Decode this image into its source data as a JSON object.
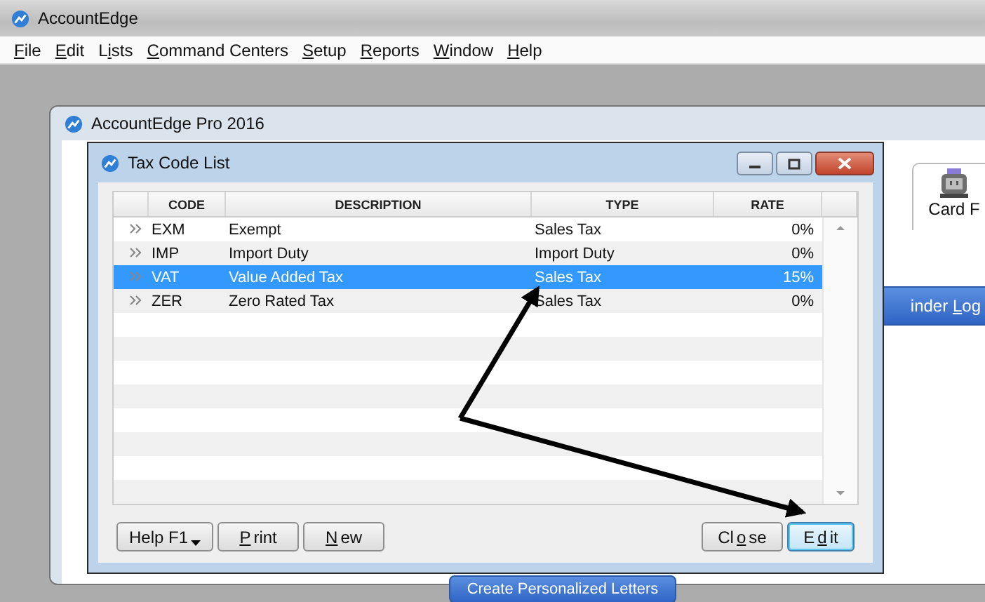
{
  "app": {
    "title": "AccountEdge"
  },
  "menu": [
    {
      "key": "F",
      "post": "ile"
    },
    {
      "key": "E",
      "post": "dit"
    },
    {
      "pre": "L",
      "key": "i",
      "post": "sts"
    },
    {
      "key": "C",
      "post": "ommand Centers"
    },
    {
      "key": "S",
      "post": "etup"
    },
    {
      "key": "R",
      "post": "eports"
    },
    {
      "key": "W",
      "post": "indow"
    },
    {
      "key": "H",
      "post": "elp"
    }
  ],
  "main_window": {
    "title": "AccountEdge Pro 2016",
    "card_tab": "Card F",
    "reminder_button": {
      "pre": "inder ",
      "key": "L",
      "post": "og"
    },
    "letters_button": "Create Personalized Letters"
  },
  "dialog": {
    "title": "Tax Code List",
    "columns": [
      "CODE",
      "DESCRIPTION",
      "TYPE",
      "RATE"
    ],
    "rows": [
      {
        "code": "EXM",
        "description": "Exempt",
        "type": "Sales Tax",
        "rate": "0%",
        "selected": false
      },
      {
        "code": "IMP",
        "description": "Import Duty",
        "type": "Import Duty",
        "rate": "0%",
        "selected": false
      },
      {
        "code": "VAT",
        "description": "Value Added Tax",
        "type": "Sales Tax",
        "rate": "15%",
        "selected": true
      },
      {
        "code": "ZER",
        "description": "Zero Rated Tax",
        "type": "Sales Tax",
        "rate": "0%",
        "selected": false
      }
    ],
    "left_buttons": [
      {
        "pre": "Help F1",
        "dropdown": true,
        "focused": false
      },
      {
        "key": "P",
        "post": "rint",
        "dropdown": false,
        "focused": false
      },
      {
        "key": "N",
        "post": "ew",
        "dropdown": false,
        "focused": false
      }
    ],
    "right_buttons": [
      {
        "pre": "Cl",
        "key": "o",
        "post": "se",
        "dropdown": false,
        "focused": false
      },
      {
        "pre": "E",
        "key": "d",
        "post": "it",
        "dropdown": false,
        "focused": true
      }
    ]
  }
}
